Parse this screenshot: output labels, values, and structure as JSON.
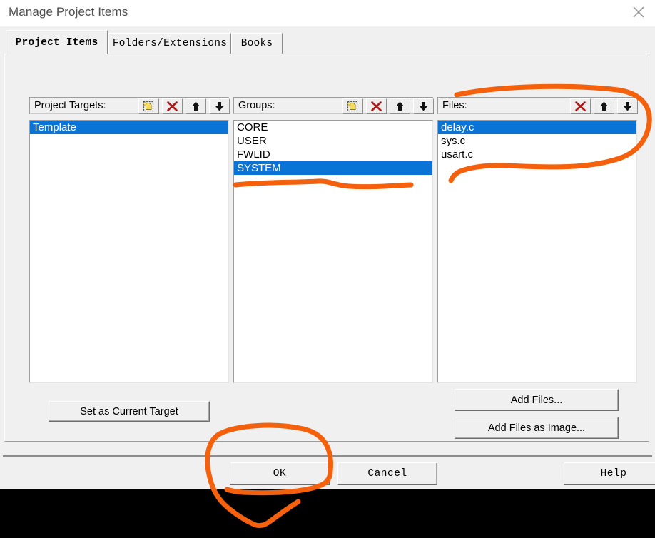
{
  "window": {
    "title": "Manage Project Items",
    "close_icon": "close-icon"
  },
  "tabs": [
    {
      "label": "Project Items",
      "active": true
    },
    {
      "label": "Folders/Extensions",
      "active": false
    },
    {
      "label": "Books",
      "active": false
    }
  ],
  "columns": {
    "targets": {
      "label": "Project Targets:",
      "buttons": [
        "new-icon",
        "delete-icon",
        "move-up-icon",
        "move-down-icon"
      ],
      "items": [
        {
          "label": "Template",
          "selected": true
        }
      ]
    },
    "groups": {
      "label": "Groups:",
      "buttons": [
        "new-icon",
        "delete-icon",
        "move-up-icon",
        "move-down-icon"
      ],
      "items": [
        {
          "label": "CORE",
          "selected": false
        },
        {
          "label": "USER",
          "selected": false
        },
        {
          "label": "FWLID",
          "selected": false
        },
        {
          "label": "SYSTEM",
          "selected": true
        }
      ]
    },
    "files": {
      "label": "Files:",
      "buttons": [
        "delete-icon",
        "move-up-icon",
        "move-down-icon"
      ],
      "items": [
        {
          "label": "delay.c",
          "selected": true
        },
        {
          "label": "sys.c",
          "selected": false
        },
        {
          "label": "usart.c",
          "selected": false
        }
      ]
    }
  },
  "buttons": {
    "set_as_current_target": "Set as Current Target",
    "add_files": "Add Files...",
    "add_files_as_image": "Add Files as Image...",
    "ok": "OK",
    "cancel": "Cancel",
    "help": "Help"
  },
  "colors": {
    "selection_blue": "#0a73d6",
    "dialog_face": "#f0f0f0",
    "annotation_orange": "#f4600c",
    "delete_red": "#b01818",
    "backdrop": "#000000"
  },
  "annotations": {
    "color": "#f4600c",
    "marks": [
      {
        "name": "files-panel-circle",
        "shape": "ellipse-loop"
      },
      {
        "name": "system-group-underline",
        "shape": "wavy-line"
      },
      {
        "name": "ok-button-circle",
        "shape": "ellipse-loop"
      }
    ]
  }
}
